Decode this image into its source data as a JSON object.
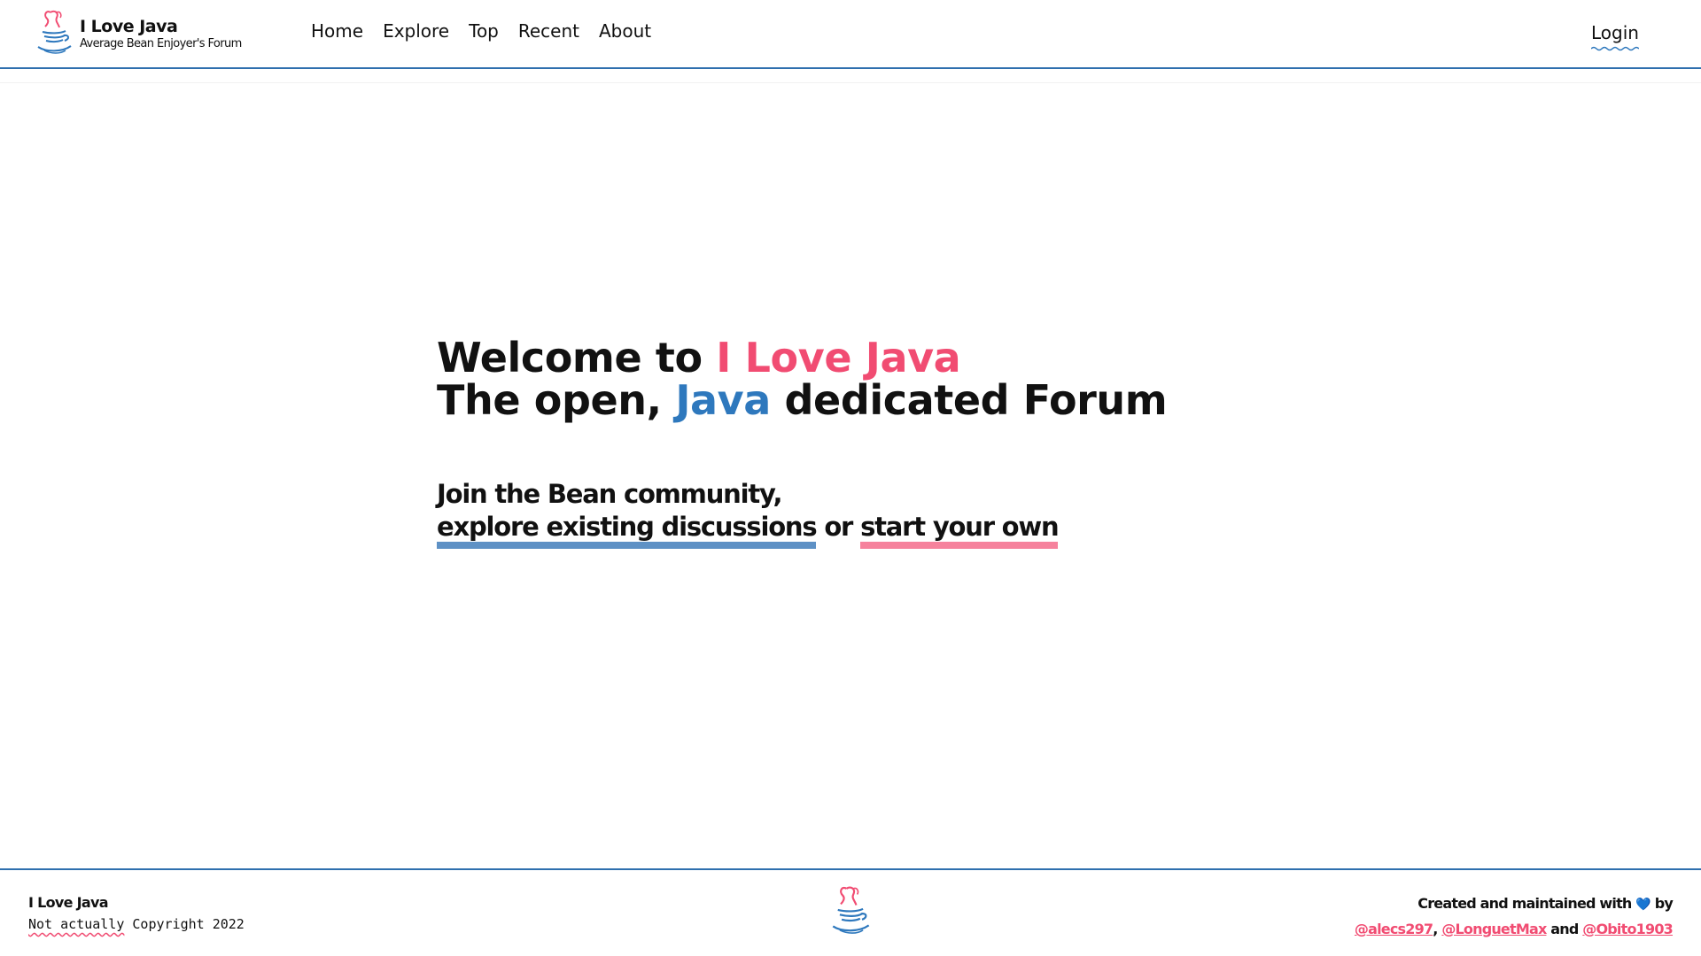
{
  "header": {
    "brand_title": "I Love Java",
    "brand_subtitle": "Average Bean Enjoyer's Forum",
    "nav": [
      "Home",
      "Explore",
      "Top",
      "Recent",
      "About"
    ],
    "login_label": "Login"
  },
  "hero": {
    "line1_prefix": "Welcome to ",
    "line1_highlight": "I Love Java",
    "line2_prefix": "The open, ",
    "line2_highlight": "Java",
    "line2_suffix": " dedicated Forum"
  },
  "cta": {
    "line1": "Join the Bean community,",
    "explore_link": "explore existing discussions",
    "connector": " or ",
    "start_link": "start your own"
  },
  "footer": {
    "title": "I Love Java",
    "copy_squiggle": "Not actually",
    "copy_rest": " Copyright 2022",
    "credits_prefix": "Created and maintained with ",
    "heart": "💙",
    "credits_by": " by",
    "handles": [
      "@alecs297",
      "@LonguetMax",
      "@Obito1903"
    ],
    "sep_comma": ", ",
    "sep_and": " and "
  },
  "colors": {
    "accent_pink": "#f14c72",
    "accent_blue": "#2e78bd",
    "border_blue": "#2e6fae"
  },
  "icons": {
    "logo": "java-coffee-cup-logo-icon",
    "heart": "blue-heart-icon"
  }
}
